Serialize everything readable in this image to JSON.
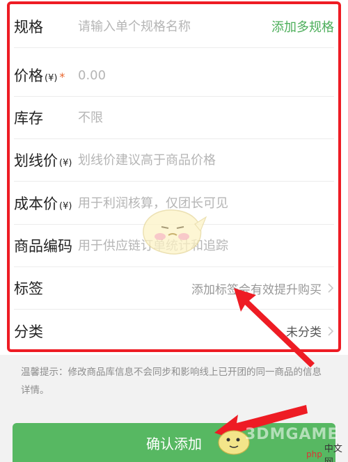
{
  "form": {
    "rows": [
      {
        "label": "规格",
        "placeholder": "请输入单个规格名称",
        "action": "添加多规格"
      },
      {
        "label": "价格",
        "unit": "(¥)",
        "required": "*",
        "placeholder": "0.00"
      },
      {
        "label": "库存",
        "placeholder": "不限"
      },
      {
        "label": "划线价",
        "unit": "(¥)",
        "placeholder": "划线价建议高于商品价格"
      },
      {
        "label": "成本价",
        "unit": "(¥)",
        "placeholder": "用于利润核算，仅团长可见"
      },
      {
        "label": "商品编码",
        "placeholder": "用于供应链订单统计和追踪"
      },
      {
        "label": "标签",
        "value": "添加标签会有效提升购买"
      },
      {
        "label": "分类",
        "value": "未分类"
      }
    ]
  },
  "tip": {
    "text": "温馨提示：修改商品库信息不会同步和影响线上已开团的同一商品的信息详情。"
  },
  "confirm_label": "确认添加",
  "watermark": {
    "text": "3DMGAME",
    "badge_php": "php",
    "badge_site": "中文网"
  },
  "colors": {
    "accent_green": "#57b862",
    "link_green": "#4cae5a",
    "highlight_red": "#ee1c24",
    "required_orange": "#e8642c"
  }
}
